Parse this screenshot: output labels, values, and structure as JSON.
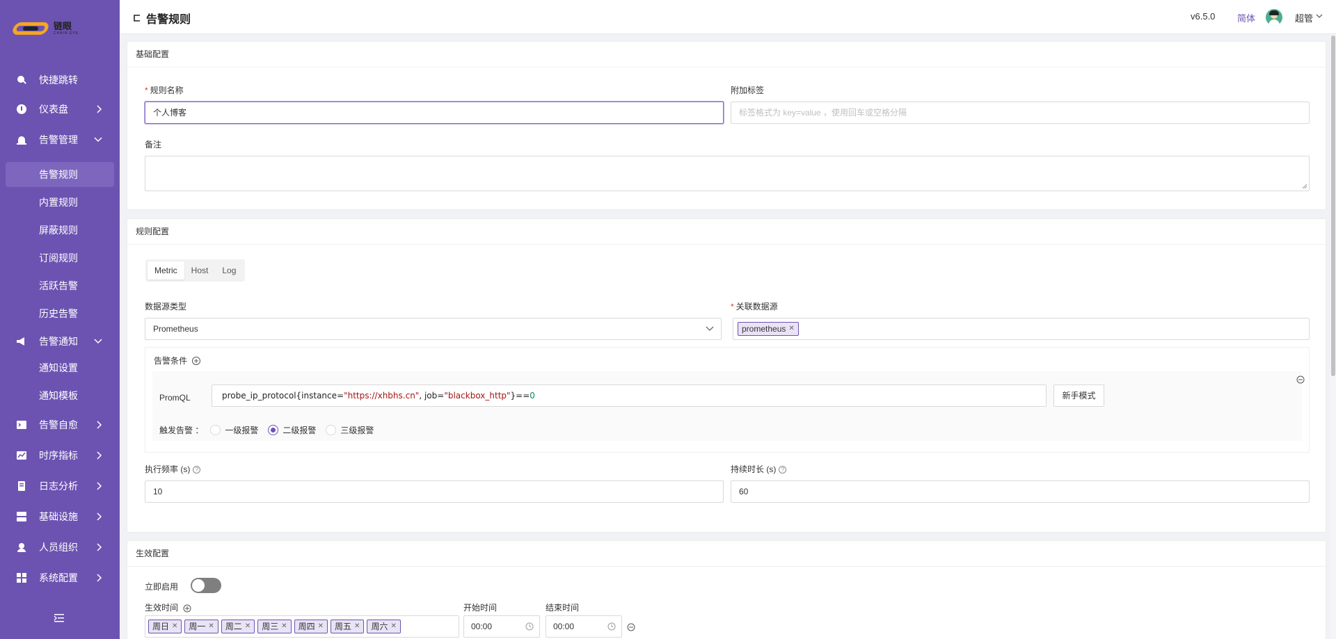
{
  "app": {
    "logo_text": "链眼",
    "logo_subtext": "CHAIN EYE"
  },
  "sidebar": {
    "items": [
      {
        "label": "快捷跳转",
        "icon": "search-icon"
      },
      {
        "label": "仪表盘",
        "icon": "dashboard-icon"
      },
      {
        "label": "告警管理",
        "icon": "alarm-icon"
      },
      {
        "label": "告警通知",
        "icon": "megaphone-icon"
      },
      {
        "label": "告警自愈",
        "icon": "terminal-icon"
      },
      {
        "label": "时序指标",
        "icon": "chart-icon"
      },
      {
        "label": "日志分析",
        "icon": "log-icon"
      },
      {
        "label": "基础设施",
        "icon": "grid-icon"
      },
      {
        "label": "人员组织",
        "icon": "user-icon"
      },
      {
        "label": "系统配置",
        "icon": "settings-icon"
      }
    ],
    "alarm_sub": [
      "告警规则",
      "内置规则",
      "屏蔽规则",
      "订阅规则",
      "活跃告警",
      "历史告警"
    ],
    "notify_sub": [
      "通知设置",
      "通知模板"
    ]
  },
  "header": {
    "title": "告警规则",
    "version": "v6.5.0",
    "language": "简体",
    "user": "超管"
  },
  "basic": {
    "section_title": "基础配置",
    "name_label": "规则名称",
    "name_value": "个人博客",
    "tags_label": "附加标签",
    "tags_placeholder": "标签格式为 key=value ，使用回车或空格分隔",
    "note_label": "备注"
  },
  "rule": {
    "section_title": "规则配置",
    "tabs": [
      "Metric",
      "Host",
      "Log"
    ],
    "active_tab": "Metric",
    "ds_type_label": "数据源类型",
    "ds_type_value": "Prometheus",
    "ds_label": "关联数据源",
    "ds_tag": "prometheus",
    "cond_title": "告警条件",
    "promql_label": "PromQL",
    "promql_fn": "probe_ip_protocol{",
    "promql_k1": "instance=",
    "promql_v1": "\"https://xhbhs.cn\"",
    "promql_sep": ", ",
    "promql_k2": "job=",
    "promql_v2": "\"blackbox_http\"",
    "promql_end": "}==",
    "promql_num": "0",
    "novice_button": "新手模式",
    "trigger_label": "触发告警 ：",
    "levels": [
      "一级报警",
      "二级报警",
      "三级报警"
    ],
    "checked_level": "二级报警",
    "interval_label": "执行频率 (s)",
    "interval_value": "10",
    "duration_label": "持续时长 (s)",
    "duration_value": "60"
  },
  "effective": {
    "section_title": "生效配置",
    "enable_label": "立即启用",
    "enabled": false,
    "time_label": "生效时间",
    "days": [
      "周日",
      "周一",
      "周二",
      "周三",
      "周四",
      "周五",
      "周六"
    ],
    "start_label": "开始时间",
    "start_value": "00:00",
    "end_label": "结束时间",
    "end_value": "00:00"
  },
  "colors": {
    "sidebar": "#6c53b1",
    "accent": "#6c53b1",
    "required": "#e03333"
  }
}
